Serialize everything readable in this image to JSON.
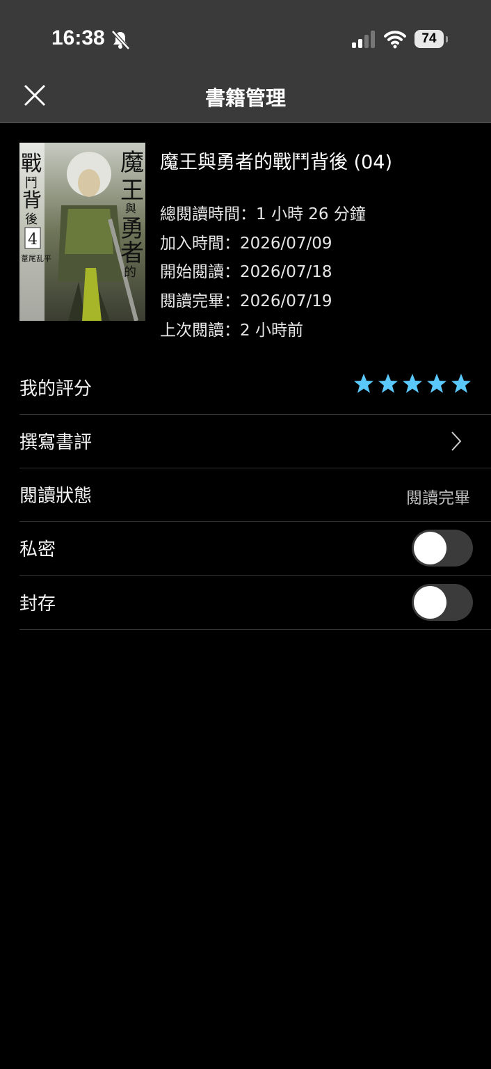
{
  "status_bar": {
    "time": "16:38",
    "battery": "74",
    "icons": [
      "bell-slash-icon",
      "signal-icon",
      "wifi-icon",
      "battery-icon"
    ]
  },
  "nav": {
    "title": "書籍管理",
    "close_icon": "close-icon"
  },
  "book": {
    "title": "魔王與勇者的戰鬥背後 (04)",
    "cover_title": "魔王與勇者的戰鬥背後",
    "cover_volume": "4",
    "cover_author": "葦尾乱平",
    "meta": [
      "總閱讀時間：1 小時 26 分鐘",
      "加入時間：2026/07/09",
      "開始閱讀：2026/07/18",
      "閱讀完畢：2026/07/19",
      "上次閱讀：2 小時前"
    ]
  },
  "settings": {
    "rating_label": "我的評分",
    "rating_value": 5,
    "rating_max": 5,
    "review_label": "撰寫書評",
    "status_label": "閱讀狀態",
    "status_value": "閱讀完畢",
    "private_label": "私密",
    "private_on": false,
    "archive_label": "封存",
    "archive_on": false
  },
  "colors": {
    "star": "#5ac8fa",
    "topbar": "#3a3a3a",
    "background": "#000000"
  }
}
